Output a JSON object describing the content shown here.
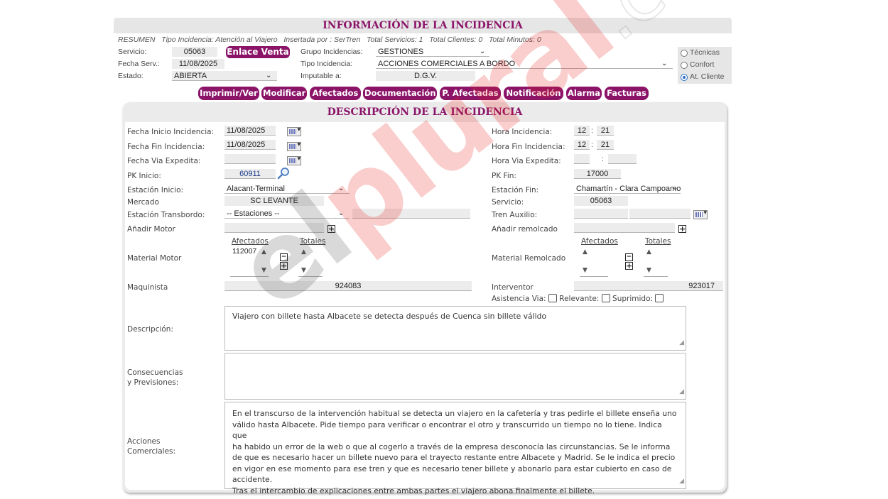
{
  "header": {
    "title": "INFORMACIÓN DE LA INCIDENCIA",
    "resumen": "RESUMEN",
    "tipo_incidencia": "Tipo Incidencia: Atención al Viajero",
    "insertada_por": "Insertada por : SerTren",
    "total_servicios": "Total Servicios: 1",
    "total_clientes": "Total Clientes: 0",
    "total_minutos": "Total Minutos: 0"
  },
  "info": {
    "servicio_label": "Servicio:",
    "servicio_value": "05063",
    "enlace_button": "Enlace Venta",
    "fecha_serv_label": "Fecha Serv.:",
    "fecha_serv_value": "11/08/2025",
    "estado_label": "Estado:",
    "estado_value": "ABIERTA",
    "grupo_label": "Grupo Incidencias:",
    "grupo_value": "GESTIONES",
    "tipo_label": "Tipo Incidencia:",
    "tipo_value": "ACCIONES COMERCIALES A BORDO",
    "imputable_label": "Imputable a:",
    "imputable_value": "D.G.V."
  },
  "radio_options": [
    {
      "label": "Técnicas",
      "selected": false
    },
    {
      "label": "Confort",
      "selected": false
    },
    {
      "label": "At. Cliente",
      "selected": true
    }
  ],
  "toolbar": {
    "imprimir": "Imprimir/Ver",
    "modificar": "Modificar",
    "afectados": "Afectados",
    "documentacion": "Documentación",
    "p_afectadas": "P. Afectadas",
    "notificacion": "Notificación",
    "alarma": "Alarma",
    "facturas": "Facturas"
  },
  "descripcion": {
    "title": "DESCRIPCIÓN DE LA INCIDENCIA",
    "fecha_inicio_label": "Fecha Inicio Incidencia:",
    "fecha_inicio_value": "11/08/2025",
    "fecha_fin_label": "Fecha Fin Incidencia:",
    "fecha_fin_value": "11/08/2025",
    "fecha_via_label": "Fecha Via Expedita:",
    "fecha_via_value": "",
    "pk_inicio_label": "PK Inicio:",
    "pk_inicio_value": "60911",
    "estacion_inicio_label": "Estación Inicio:",
    "estacion_inicio_value": "Alacant-Terminal",
    "mercado_label": "Mercado",
    "mercado_value": "SC LEVANTE",
    "estacion_transbordo_label": "Estación Transbordo:",
    "estacion_transbordo_value": "-- Estaciones --",
    "anadir_motor_label": "Añadir Motor",
    "afectados_label": "Afectados",
    "totales_label": "Totales",
    "material_motor_label": "Material Motor",
    "material_motor_value": "112007",
    "maquinista_label": "Maquinista",
    "maquinista_value": "924083",
    "hora_incidencia_label": "Hora Incidencia:",
    "hora_incidencia_h": "12",
    "hora_incidencia_m": "21",
    "hora_fin_label": "Hora Fin Incidencia:",
    "hora_fin_h": "12",
    "hora_fin_m": "21",
    "hora_via_label": "Hora Via Expedita:",
    "hora_sep": ":",
    "pk_fin_label": "PK Fin:",
    "pk_fin_value": "17000",
    "estacion_fin_label": "Estación Fin:",
    "estacion_fin_value": "Chamartín - Clara Campoamor",
    "servicio_label": "Servicio:",
    "servicio_value": "05063",
    "tren_auxilio_label": "Tren Auxilio:",
    "anadir_remolcado_label": "Añadir remolcado",
    "material_remolcado_label": "Material Remolcado",
    "interventor_label": "Interventor",
    "interventor_value": "923017",
    "asistencia_label": "Asistencia Via:",
    "relevante_label": "Relevante:",
    "suprimido_label": "Suprimido:",
    "descripcion_label": "Descripción:",
    "descripcion_text": "Viajero con billete hasta Albacete se detecta después de Cuenca sin billete válido",
    "consecuencias_label_1": "Consecuencias",
    "consecuencias_label_2": "y Previsiones:",
    "consecuencias_text": "",
    "acciones_label_1": "Acciones",
    "acciones_label_2": "Comerciales:",
    "acciones_lines": [
      "En el transcurso de la intervención habitual se detecta un viajero en la cafetería y tras pedirle el billete enseña uno",
      "válido hasta Albacete. Pide tiempo para verificar o encontrar el otro y transcurrido un tiempo no lo tiene. Indica que",
      "ha habido un error de la web o que al cogerlo a través de la empresa desconocía las circunstancias. Se le informa",
      "de que es necesario hacer un billete nuevo para el trayecto restante entre Albacete y Madrid. Se le indica el precio",
      "en vigor en ese momento para ese tren y que es necesario tener billete y abonarlo para estar cubierto en caso de",
      "accidente.",
      "Tras el intercambio de explicaciones entre ambas partes el viajero abona finalmente el billete."
    ]
  },
  "watermark": "elplural.com"
}
